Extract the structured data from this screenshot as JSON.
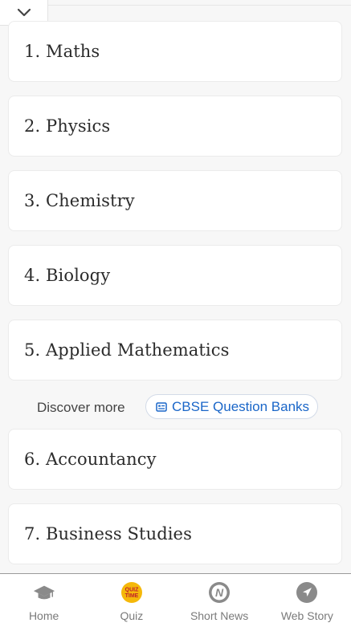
{
  "subjects": [
    {
      "label": "1. Maths"
    },
    {
      "label": "2. Physics"
    },
    {
      "label": "3. Chemistry"
    },
    {
      "label": "4. Biology"
    },
    {
      "label": "5. Applied Mathematics"
    },
    {
      "label": "6. Accountancy"
    },
    {
      "label": "7. Business Studies"
    }
  ],
  "discover": {
    "label": "Discover more",
    "chip_label": "CBSE Question Banks",
    "chip_icon": "list-document-icon"
  },
  "nav": {
    "items": [
      {
        "label": "Home",
        "icon": "graduation-cap-icon"
      },
      {
        "label": "Quiz",
        "icon": "quiz-time-icon",
        "badge_line1": "QUIZ",
        "badge_line2": "TIME"
      },
      {
        "label": "Short News",
        "icon": "short-news-icon",
        "glyph": "N"
      },
      {
        "label": "Web Story",
        "icon": "compass-arrow-icon"
      }
    ]
  },
  "colors": {
    "accent": "#1a66c8",
    "quiz_badge": "#f5b80a",
    "nav_icon_gray": "#8a8a8a"
  }
}
